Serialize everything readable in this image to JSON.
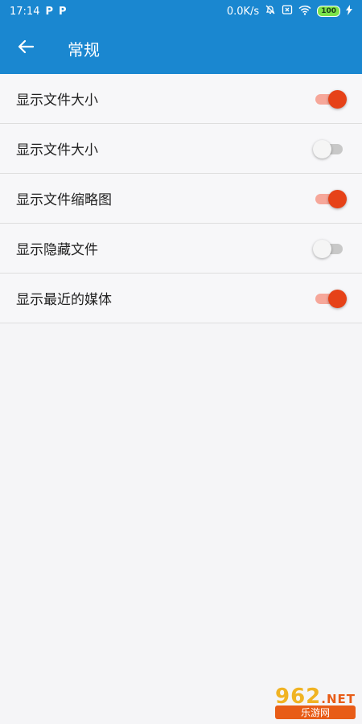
{
  "status_bar": {
    "time": "17:14",
    "app_badges": [
      "P",
      "P"
    ],
    "network_speed": "0.0K/s",
    "battery": "100"
  },
  "app_bar": {
    "title": "常规",
    "back_icon": "arrow-left-icon"
  },
  "settings": [
    {
      "label": "显示文件大小",
      "enabled": true
    },
    {
      "label": "显示文件大小",
      "enabled": false
    },
    {
      "label": "显示文件缩略图",
      "enabled": true
    },
    {
      "label": "显示隐藏文件",
      "enabled": false
    },
    {
      "label": "显示最近的媒体",
      "enabled": true
    }
  ],
  "watermark": {
    "top": "962",
    "suffix": ".NET",
    "bottom": "乐游网"
  },
  "colors": {
    "primary": "#1a87d0",
    "switch_on_thumb": "#e64218",
    "switch_on_track": "#f6a79a",
    "switch_off_thumb": "#f5f5f5",
    "switch_off_track": "#c8c8c8",
    "background": "#f5f5f7"
  }
}
